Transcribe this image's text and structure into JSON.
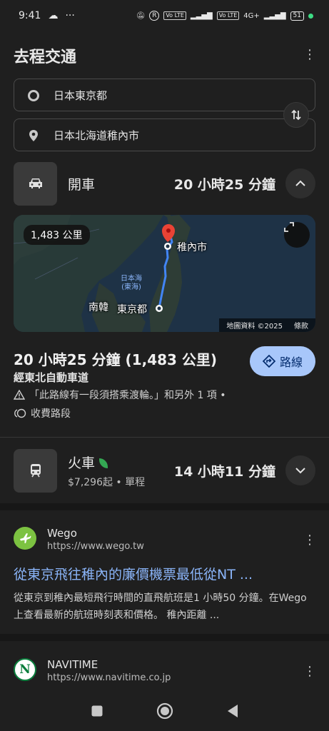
{
  "status_bar": {
    "time": "9:41",
    "network_chip": "VoLTE",
    "signal_label": "4G+",
    "battery": "51"
  },
  "header": {
    "title": "去程交通"
  },
  "origin": {
    "value": "日本東京都"
  },
  "destination": {
    "value": "日本北海道稚內市"
  },
  "drive": {
    "label": "開車",
    "duration": "20 小時25 分鐘"
  },
  "map": {
    "distance_pill": "1,483 公里",
    "label_dest": "稚內市",
    "label_origin": "東京都",
    "label_korea": "南韓",
    "label_sea": "日本海\n(東海)",
    "attribution": "地圖資料 ©2025",
    "terms": "條款"
  },
  "summary": {
    "main": "20 小時25 分鐘 (1,483 公里)",
    "via": "經東北自動車道",
    "warning": "「此路線有一段須搭乘渡輪。」和另外 1 項  •",
    "toll": "收費路段",
    "route_button": "路線"
  },
  "train": {
    "label": "火車",
    "price": "$7,296起 • 單程",
    "duration": "14 小時11 分鐘"
  },
  "results": [
    {
      "site": "Wego",
      "url": "https://www.wego.tw",
      "title": "從東京飛往稚內的廉價機票最低從NT ...",
      "desc": "從東京到稚內最短飛行時間的直飛航班是1 小時50 分鐘。在Wego 上查看最新的航班時刻表和價格。 稚內距離 ...",
      "favicon_color": "#7cc241"
    },
    {
      "site": "NAVITIME",
      "url": "https://www.navitime.co.jp",
      "favicon_letter": "N",
      "favicon_color": "#0a7d3c"
    }
  ],
  "colors": {
    "background": "#1f1f1f",
    "link_blue": "#8ab4f8",
    "route_button_bg": "#a8c7fa",
    "map_route": "#4285f4",
    "pin_red": "#ea4335"
  }
}
